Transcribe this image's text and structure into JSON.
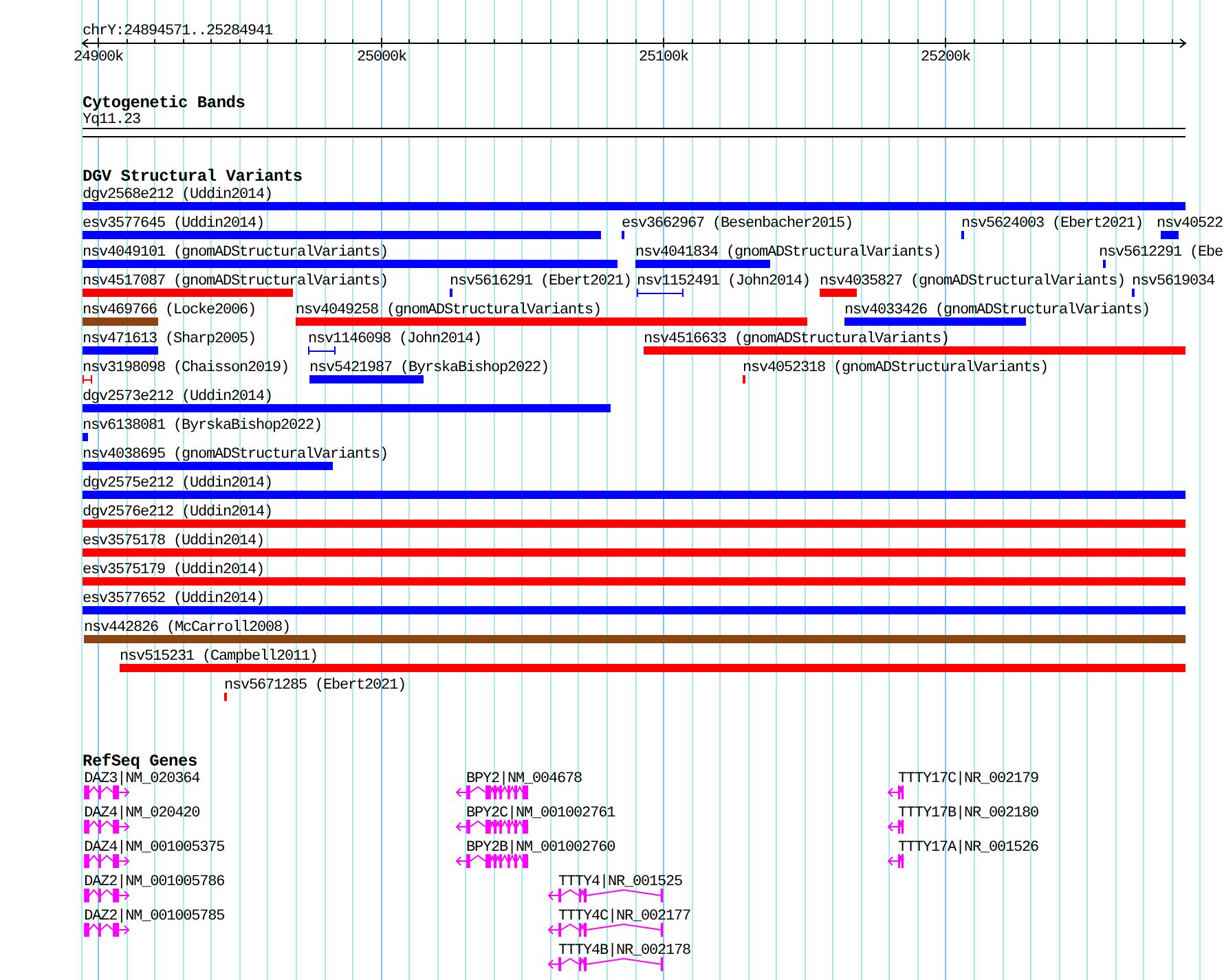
{
  "ruler": {
    "location": "chrY:24894571..25284941",
    "ticks": [
      "24900k",
      "25000k",
      "25100k",
      "25200k"
    ]
  },
  "cytogenetic_bands": {
    "title": "Cytogenetic Bands",
    "bands": [
      {
        "label": "Yq11.23"
      }
    ]
  },
  "dgv_structural_variants": {
    "title": "DGV Structural Variants",
    "features": [
      {
        "label": "dgv2568e212 (Uddin2014)",
        "kind": "bar",
        "color": "#0000ff"
      },
      {
        "label": "esv3577645 (Uddin2014)",
        "kind": "bar",
        "color": "#0000ff"
      },
      {
        "label": "esv3662967 (Besenbacher2015)",
        "kind": "bar",
        "color": "#0000ff"
      },
      {
        "label": "nsv5624003 (Ebert2021)",
        "kind": "bar",
        "color": "#0000ff"
      },
      {
        "label": "nsv40522",
        "kind": "bar",
        "color": "#0000ff"
      },
      {
        "label": "nsv4049101 (gnomADStructuralVariants)",
        "kind": "bar",
        "color": "#0000ff"
      },
      {
        "label": "nsv4041834 (gnomADStructuralVariants)",
        "kind": "bar",
        "color": "#0000ff"
      },
      {
        "label": "nsv5612291 (Ebe",
        "kind": "bar",
        "color": "#0000ff"
      },
      {
        "label": "nsv4517087 (gnomADStructuralVariants)",
        "kind": "bar",
        "color": "#ff0000"
      },
      {
        "label": "nsv5616291 (Ebert2021)",
        "kind": "bar",
        "color": "#0000ff"
      },
      {
        "label": "nsv1152491 (John2014)",
        "kind": "span",
        "color": "#0000ff"
      },
      {
        "label": "nsv4035827 (gnomADStructuralVariants)",
        "kind": "bar",
        "color": "#ff0000"
      },
      {
        "label": "nsv5619034",
        "kind": "bar",
        "color": "#0000ff"
      },
      {
        "label": "nsv469766 (Locke2006)",
        "kind": "bar",
        "color": "#8b4513"
      },
      {
        "label": "nsv4049258 (gnomADStructuralVariants)",
        "kind": "bar",
        "color": "#ff0000"
      },
      {
        "label": "nsv4033426 (gnomADStructuralVariants)",
        "kind": "bar",
        "color": "#0000ff"
      },
      {
        "label": "nsv471613 (Sharp2005)",
        "kind": "bar",
        "color": "#0000ff"
      },
      {
        "label": "nsv1146098 (John2014)",
        "kind": "span",
        "color": "#0000ff"
      },
      {
        "label": "nsv4516633 (gnomADStructuralVariants)",
        "kind": "bar",
        "color": "#ff0000"
      },
      {
        "label": "nsv3198098 (Chaisson2019)",
        "kind": "span",
        "color": "#ff0000"
      },
      {
        "label": "nsv5421987 (ByrskaBishop2022)",
        "kind": "bar",
        "color": "#0000ff"
      },
      {
        "label": "nsv4052318 (gnomADStructuralVariants)",
        "kind": "bar",
        "color": "#ff0000"
      },
      {
        "label": "dgv2573e212 (Uddin2014)",
        "kind": "bar",
        "color": "#0000ff"
      },
      {
        "label": "nsv6138081 (ByrskaBishop2022)",
        "kind": "bar",
        "color": "#0000ff"
      },
      {
        "label": "nsv4038695 (gnomADStructuralVariants)",
        "kind": "bar",
        "color": "#0000ff"
      },
      {
        "label": "dgv2575e212 (Uddin2014)",
        "kind": "bar",
        "color": "#0000ff"
      },
      {
        "label": "dgv2576e212 (Uddin2014)",
        "kind": "bar",
        "color": "#ff0000"
      },
      {
        "label": "esv3575178 (Uddin2014)",
        "kind": "bar",
        "color": "#ff0000"
      },
      {
        "label": "esv3575179 (Uddin2014)",
        "kind": "bar",
        "color": "#ff0000"
      },
      {
        "label": "esv3577652 (Uddin2014)",
        "kind": "bar",
        "color": "#0000ff"
      },
      {
        "label": "nsv442826 (McCarroll2008)",
        "kind": "bar",
        "color": "#8b4513"
      },
      {
        "label": "nsv515231 (Campbell2011)",
        "kind": "bar",
        "color": "#ff0000"
      },
      {
        "label": "nsv5671285 (Ebert2021)",
        "kind": "bar",
        "color": "#ff0000"
      }
    ]
  },
  "refseq_genes": {
    "title": "RefSeq Genes",
    "genes": [
      {
        "label": "DAZ3|NM_020364",
        "reverse_strand": false
      },
      {
        "label": "BPY2|NM_004678",
        "reverse_strand": true
      },
      {
        "label": "TTTY17C|NR_002179",
        "reverse_strand": true
      },
      {
        "label": "DAZ4|NM_020420",
        "reverse_strand": false
      },
      {
        "label": "BPY2C|NM_001002761",
        "reverse_strand": true
      },
      {
        "label": "TTTY17B|NR_002180",
        "reverse_strand": true
      },
      {
        "label": "DAZ4|NM_001005375",
        "reverse_strand": false
      },
      {
        "label": "BPY2B|NM_001002760",
        "reverse_strand": true
      },
      {
        "label": "TTTY17A|NR_001526",
        "reverse_strand": true
      },
      {
        "label": "DAZ2|NM_001005786",
        "reverse_strand": false
      },
      {
        "label": "TTTY4|NR_001525",
        "reverse_strand": true
      },
      {
        "label": "DAZ2|NM_001005785",
        "reverse_strand": false
      },
      {
        "label": "TTTY4C|NR_002177",
        "reverse_strand": true
      },
      {
        "label": "TTTY4B|NR_002178",
        "reverse_strand": true
      }
    ]
  }
}
